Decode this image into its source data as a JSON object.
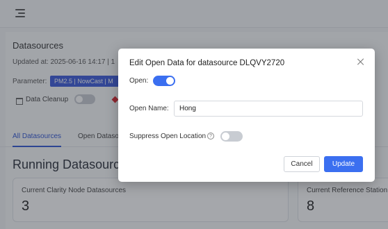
{
  "page": {
    "title": "Datasources",
    "updated_label": "Updated at:",
    "updated_value": "2025-06-16 14:17 | 1",
    "parameter_label": "Parameter:",
    "parameter_value": "PM2.5 | NowCast | M",
    "cleanup_label": "Data Cleanup",
    "tabs": [
      "All Datasources",
      "Open Dataso"
    ],
    "section_title": "Running Datasource",
    "cards": [
      {
        "label": "Current Clarity Node Datasources",
        "value": "3"
      },
      {
        "label": "Current Reference Station",
        "value": "8"
      }
    ]
  },
  "modal": {
    "title": "Edit Open Data for datasource DLQVY2720",
    "open_label": "Open:",
    "open_value": true,
    "open_name_label": "Open Name:",
    "open_name_value": "Hong",
    "suppress_label": "Suppress Open Location",
    "suppress_value": false,
    "help_glyph": "?",
    "cancel_label": "Cancel",
    "update_label": "Update"
  },
  "colors": {
    "accent": "#3b6ff0",
    "chip": "#3b5bdb",
    "alert": "#d9242b"
  },
  "icons": [
    "menu-icon",
    "cleanup-icon",
    "close-icon",
    "help-icon"
  ]
}
